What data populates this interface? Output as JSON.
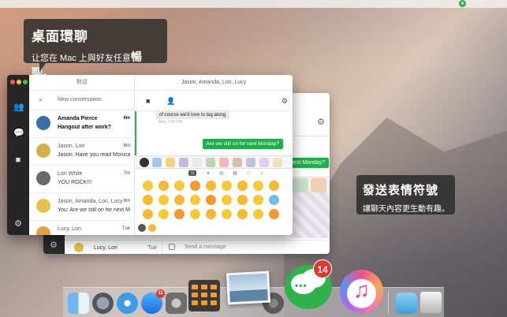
{
  "callouts": {
    "top": {
      "title": "桌面環聊",
      "subtitle_prefix": "让您在 Mac 上與好友任意",
      "subtitle_strong": "暢聊。"
    },
    "right": {
      "title": "發送表情符號",
      "subtitle": "讓聊天內容更生動有趣。"
    }
  },
  "menubar": {
    "icon": "line-icon"
  },
  "main_window": {
    "list_title": "對話",
    "search_placeholder": "New conversation",
    "chat_title": "Jason, Amanda, Lori, Lucy",
    "conversations": [
      {
        "name": "Amanda Pierce",
        "preview": "Hangout after work?",
        "time": "4m",
        "unread": true,
        "avatar_color": "#3b6ea5"
      },
      {
        "name": "Jason, Lori",
        "preview": "Jason: Have you read Monica's",
        "time": "6m",
        "unread": false,
        "avatar_color": "#d8b04a"
      },
      {
        "name": "Lori White",
        "preview": "YOU ROCK!!!",
        "time": "7m",
        "unread": false,
        "avatar_color": "#6a6a6a"
      },
      {
        "name": "Jason, Amanda, Lori, Lucy",
        "preview": "You: Are we still on for next Mo",
        "time": "8m",
        "unread": false,
        "avatar_color": "#e6c24a"
      },
      {
        "name": "Lucy, Lori",
        "preview": "",
        "time": "Tue",
        "unread": false,
        "avatar_color": "#e0a43a"
      }
    ],
    "messages": {
      "incoming": "of course we'd love to tag along",
      "incoming_meta": "Amy 7:06 PM",
      "outgoing": "Are we still on for next Monday?",
      "outgoing_meta": "✓"
    },
    "emoji_tabs": [
      "☺",
      "✶",
      "⚙",
      "✿",
      "⌂",
      "♪"
    ]
  },
  "back_window": {
    "bubble": "Next Monday?",
    "row_name": "Lucy, Lori",
    "row_time": "Tue",
    "compose_placeholder": "Send a message"
  },
  "dock": {
    "app_store_badge": "11",
    "line_badge": "14"
  },
  "colors": {
    "accent_green": "#1fae4a",
    "badge_red": "#e0362f",
    "sidebar_dark": "#262626"
  }
}
